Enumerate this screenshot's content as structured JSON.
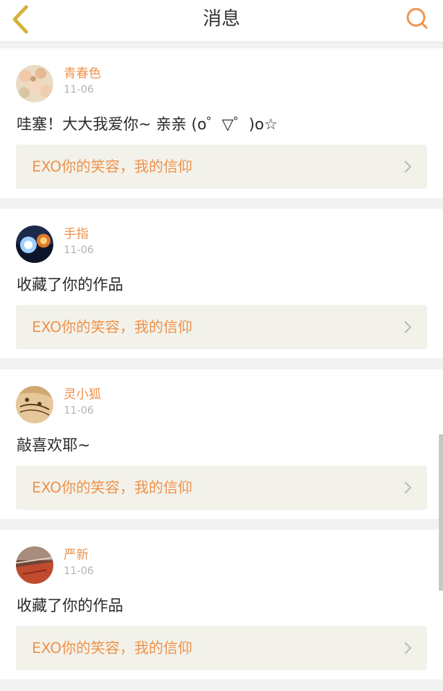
{
  "header": {
    "title": "消息",
    "back_icon": "chevron-left-icon",
    "search_icon": "search-icon"
  },
  "colors": {
    "accent": "#f0914a",
    "back": "#d4b23a",
    "card_bg": "#ffffff",
    "work_bg": "#f2f2ea"
  },
  "messages": [
    {
      "username": "青春色",
      "time": "11-06",
      "text": "哇塞！大大我爱你~ 亲亲 (o゜▽゜)o☆",
      "work_title": "EXO你的笑容，我的信仰"
    },
    {
      "username": "手指",
      "time": "11-06",
      "text": "收藏了你的作品",
      "work_title": "EXO你的笑容，我的信仰"
    },
    {
      "username": "灵小狐",
      "time": "11-06",
      "text": "敲喜欢耶~",
      "work_title": "EXO你的笑容，我的信仰"
    },
    {
      "username": "严新",
      "time": "11-06",
      "text": "收藏了你的作品",
      "work_title": "EXO你的笑容，我的信仰"
    }
  ]
}
